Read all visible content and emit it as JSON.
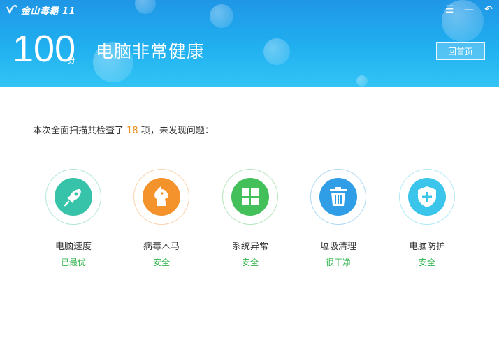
{
  "app": {
    "title": "金山毒霸 11"
  },
  "window_controls": {
    "menu": "☰",
    "minimize": "—",
    "back": "↶"
  },
  "header": {
    "score": "100",
    "score_unit": "分",
    "status_title": "电脑非常健康",
    "home_button": "回首页"
  },
  "summary": {
    "prefix": "本次全面扫描共检查了 ",
    "count": "18",
    "suffix": " 项，未发现问题："
  },
  "colors": {
    "header_top": "#1f96e6",
    "header_bottom": "#32c4f5",
    "accent_orange": "#f0901e",
    "status_green": "#2fb34a"
  },
  "items": [
    {
      "name": "电脑速度",
      "status": "已最优",
      "icon": "rocket-icon",
      "color": "#37c3a9"
    },
    {
      "name": "病毒木马",
      "status": "安全",
      "icon": "trojan-horse-icon",
      "color": "#f4922c"
    },
    {
      "name": "系统异常",
      "status": "安全",
      "icon": "windows-icon",
      "color": "#43c05a"
    },
    {
      "name": "垃圾清理",
      "status": "很干净",
      "icon": "trash-icon",
      "color": "#2f9ee6"
    },
    {
      "name": "电脑防护",
      "status": "安全",
      "icon": "shield-icon",
      "color": "#3cc5ea"
    }
  ]
}
